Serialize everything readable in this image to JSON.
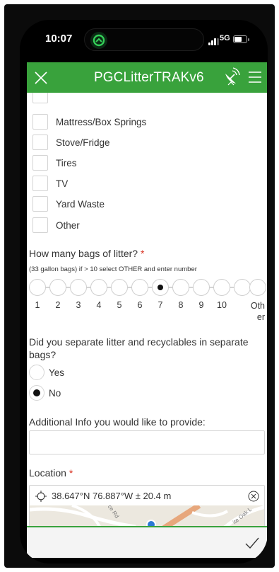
{
  "status_bar": {
    "time": "10:07",
    "network": "5G"
  },
  "header": {
    "title": "PGCLitterTRAKv6",
    "color": "#39a23c"
  },
  "checkbox_items": [
    "Mattress/Box Springs",
    "Stove/Fridge",
    "Tires",
    "TV",
    "Yard Waste",
    "Other"
  ],
  "bags_question": {
    "label": "How many bags of litter?",
    "required_mark": "*",
    "hint": "(33 gallon bags) if > 10 select OTHER and enter number",
    "options": [
      "1",
      "2",
      "3",
      "4",
      "5",
      "6",
      "7",
      "8",
      "9",
      "10"
    ],
    "other_option": "Oth er",
    "selected": "7"
  },
  "separate_question": {
    "label": "Did you separate litter and recyclables in separate bags?",
    "options": [
      "Yes",
      "No"
    ],
    "selected": "No"
  },
  "additional_info": {
    "label": "Additional Info you would like to provide:",
    "value": ""
  },
  "location": {
    "label": "Location",
    "required_mark": "*",
    "value": "38.647°N 76.887°W ± 20.4 m",
    "map_street_labels": [
      "ce Rd",
      "ite Oak L"
    ]
  },
  "icons": {
    "close": "close-icon",
    "satellite": "satellite-dish-icon",
    "menu": "hamburger-menu-icon",
    "crosshair": "crosshair-icon",
    "clear": "clear-circle-icon",
    "submit": "checkmark-icon"
  }
}
